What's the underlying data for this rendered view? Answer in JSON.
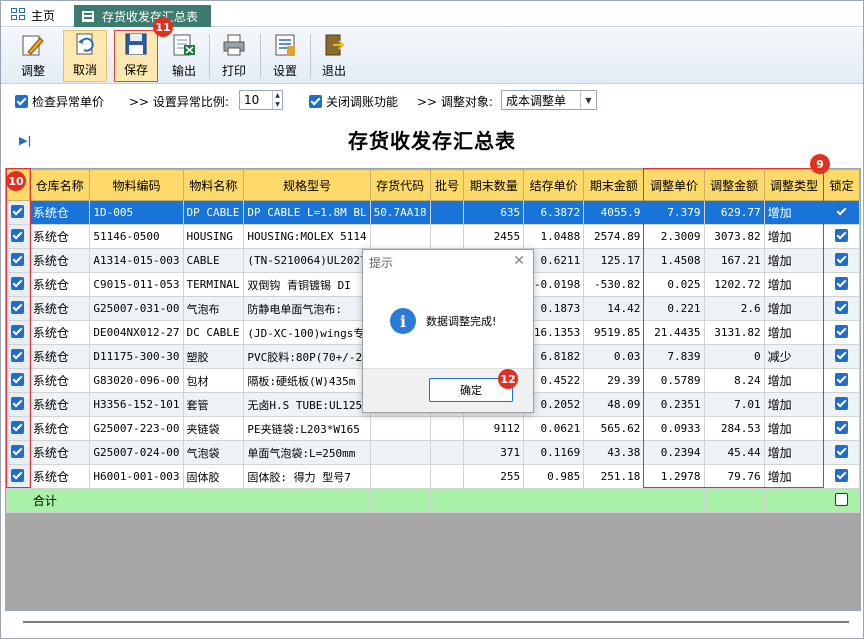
{
  "tabs": {
    "home": "主页",
    "active": "存货收发存汇总表"
  },
  "toolbar": {
    "adjust": "调整",
    "cancel": "取消",
    "save": "保存",
    "export": "输出",
    "print": "打印",
    "settings": "设置",
    "exit": "退出"
  },
  "options": {
    "check_abnormal_price": "检查异常单价",
    "set_ratio_label": ">> 设置异常比例:",
    "ratio_value": "10",
    "close_adjust": "关闭调账功能",
    "adjust_target_label": ">> 调整对象:",
    "adjust_target_value": "成本调整单"
  },
  "report_title": "存货收发存汇总表",
  "columns": [
    "仓库名称",
    "物料编码",
    "物料名称",
    "规格型号",
    "存货代码",
    "批号",
    "期末数量",
    "结存单价",
    "期末金额",
    "调整单价",
    "调整金额",
    "调整类型",
    "锁定"
  ],
  "rows": [
    {
      "wh": "系统仓",
      "code": "1D-005",
      "name": "DP CABLE",
      "spec": "DP CABLE L=1.8M BL",
      "inv": "50.7AA18",
      "batch": "",
      "qty": "635",
      "unit": "6.3872",
      "amt": "4055.9",
      "adj_price": "7.379",
      "adj_amt": "629.77",
      "type": "增加"
    },
    {
      "wh": "系统仓",
      "code": "51146-0500",
      "name": "HOUSING",
      "spec": "HOUSING:MOLEX 5114",
      "inv": "",
      "batch": "",
      "qty": "2455",
      "unit": "1.0488",
      "amt": "2574.89",
      "adj_price": "2.3009",
      "adj_amt": "3073.82",
      "type": "增加"
    },
    {
      "wh": "系统仓",
      "code": "A1314-015-003",
      "name": "CABLE",
      "spec": "(TN-S210064)UL2027",
      "inv": "",
      "batch": "",
      "qty": "",
      "unit": "0.6211",
      "amt": "125.17",
      "adj_price": "1.4508",
      "adj_amt": "167.21",
      "type": "增加"
    },
    {
      "wh": "系统仓",
      "code": "C9015-011-053",
      "name": "TERMINAL",
      "spec": "双倒钩 青铜镀锡 DI",
      "inv": "",
      "batch": "",
      "qty": "",
      "unit": "-0.0198",
      "amt": "-530.82",
      "adj_price": "0.025",
      "adj_amt": "1202.72",
      "type": "增加"
    },
    {
      "wh": "系统仓",
      "code": "G25007-031-00",
      "name": "气泡布",
      "spec": "防静电单面气泡布:",
      "inv": "",
      "batch": "",
      "qty": "",
      "unit": "0.1873",
      "amt": "14.42",
      "adj_price": "0.221",
      "adj_amt": "2.6",
      "type": "增加"
    },
    {
      "wh": "系统仓",
      "code": "DE004NX012-27",
      "name": "DC CABLE",
      "spec": "(JD-XC-100)wings专",
      "inv": "",
      "batch": "",
      "qty": "",
      "unit": "16.1353",
      "amt": "9519.85",
      "adj_price": "21.4435",
      "adj_amt": "3131.82",
      "type": "增加"
    },
    {
      "wh": "系统仓",
      "code": "D11175-300-30",
      "name": "塑胶",
      "spec": "PVC胶料:80P(70+/-2",
      "inv": "",
      "batch": "",
      "qty": "",
      "unit": "6.8182",
      "amt": "0.03",
      "adj_price": "7.839",
      "adj_amt": "0",
      "type": "减少"
    },
    {
      "wh": "系统仓",
      "code": "G83020-096-00",
      "name": "包材",
      "spec": "隔板:硬纸板(W)435m",
      "inv": "",
      "batch": "",
      "qty": "",
      "unit": "0.4522",
      "amt": "29.39",
      "adj_price": "0.5789",
      "adj_amt": "8.24",
      "type": "增加"
    },
    {
      "wh": "系统仓",
      "code": "H3356-152-101",
      "name": "套管",
      "spec": "无卤H.S TUBE:UL125",
      "inv": "",
      "batch": "",
      "qty": "",
      "unit": "0.2052",
      "amt": "48.09",
      "adj_price": "0.2351",
      "adj_amt": "7.01",
      "type": "增加"
    },
    {
      "wh": "系统仓",
      "code": "G25007-223-00",
      "name": "夹链袋",
      "spec": "PE夹链袋:L203*W165",
      "inv": "",
      "batch": "",
      "qty": "9112",
      "unit": "0.0621",
      "amt": "565.62",
      "adj_price": "0.0933",
      "adj_amt": "284.53",
      "type": "增加"
    },
    {
      "wh": "系统仓",
      "code": "G25007-024-00",
      "name": "气泡袋",
      "spec": "单面气泡袋:L=250mm",
      "inv": "",
      "batch": "",
      "qty": "371",
      "unit": "0.1169",
      "amt": "43.38",
      "adj_price": "0.2394",
      "adj_amt": "45.44",
      "type": "增加"
    },
    {
      "wh": "系统仓",
      "code": "H6001-001-003",
      "name": "固体胶",
      "spec": "固体胶: 得力 型号7",
      "inv": "",
      "batch": "",
      "qty": "255",
      "unit": "0.985",
      "amt": "251.18",
      "adj_price": "1.2978",
      "adj_amt": "79.76",
      "type": "增加"
    }
  ],
  "total_label": "合计",
  "dialog": {
    "title": "提示",
    "message": "数据调整完成!",
    "ok": "确定"
  },
  "badges": {
    "b9": "9",
    "b10": "10",
    "b11": "11",
    "b12": "12"
  },
  "colors": {
    "header_bg": "#fdd96a",
    "selected_row": "#1874d9",
    "total_row": "#a9f0a9",
    "tab_active": "#3c7b6f",
    "highlight_red": "#e03030"
  }
}
